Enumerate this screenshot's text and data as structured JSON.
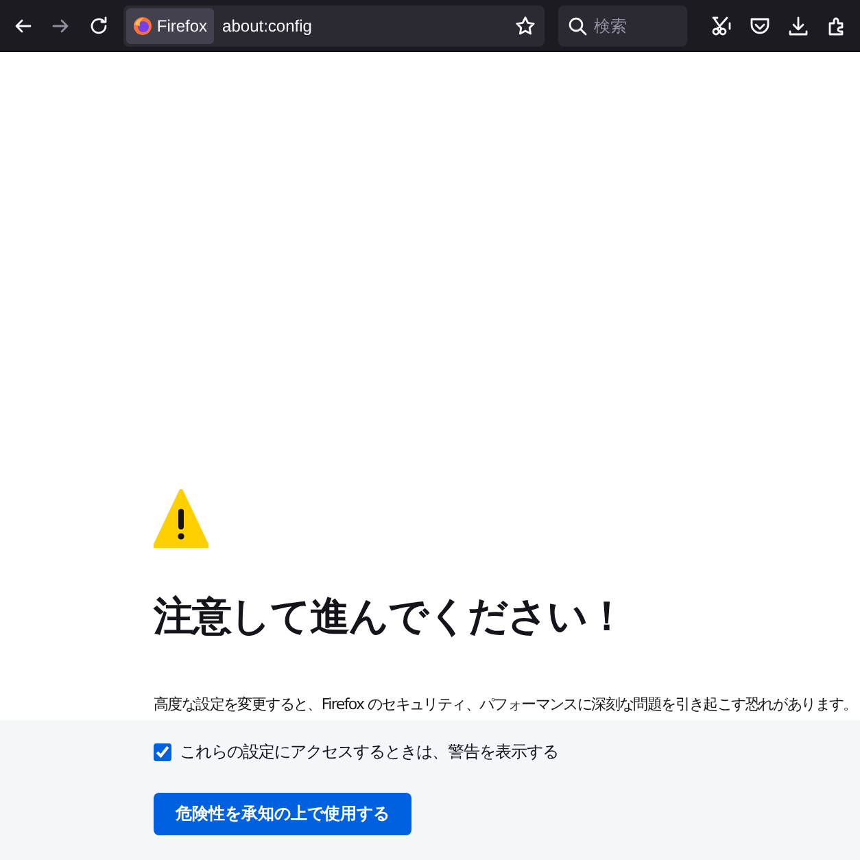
{
  "toolbar": {
    "back_disabled": false,
    "forward_disabled": true,
    "identity_label": "Firefox",
    "url": "about:config",
    "search": {
      "placeholder": "検索"
    }
  },
  "warning": {
    "title": "注意して進んでください！",
    "message": "高度な設定を変更すると、Firefox のセキュリティ、パフォーマンスに深刻な問題を引き起こす恐れがあります。"
  },
  "footer": {
    "checkbox": {
      "label": "これらの設定にアクセスするときは、警告を表示する",
      "checked": true
    },
    "button": "危険性を承知の上で使用する"
  }
}
